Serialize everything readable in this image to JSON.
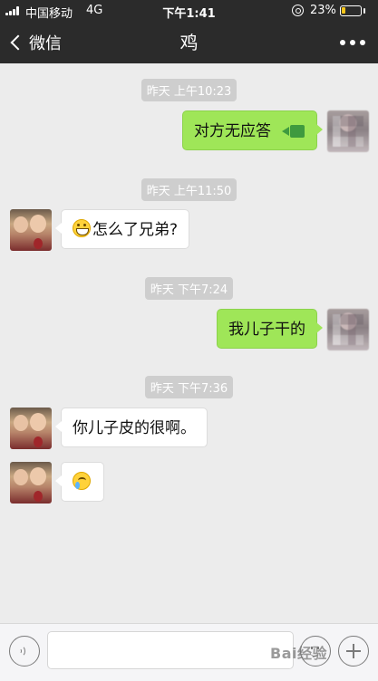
{
  "status_bar": {
    "carrier": "中国移动",
    "network": "4G",
    "time": "下午1:41",
    "battery": "23%",
    "battery_level": 0.23,
    "battery_color": "#f5c518"
  },
  "nav": {
    "back_label": "微信",
    "title": "鸡",
    "back_icon": "chevron-left-icon",
    "more_icon": "more-dots-icon"
  },
  "messages": [
    {
      "type": "timestamp",
      "text": "昨天 上午10:23"
    },
    {
      "type": "message",
      "sender": "me",
      "text": "对方无应答",
      "icon": "video-call-icon"
    },
    {
      "type": "timestamp",
      "text": "昨天 上午11:50"
    },
    {
      "type": "message",
      "sender": "them",
      "emoji": "grin-emoji-icon",
      "text": "怎么了兄弟?"
    },
    {
      "type": "timestamp",
      "text": "昨天 下午7:24"
    },
    {
      "type": "message",
      "sender": "me",
      "text": "我儿子干的"
    },
    {
      "type": "timestamp",
      "text": "昨天 下午7:36"
    },
    {
      "type": "message",
      "sender": "them",
      "text": "你儿子皮的很啊。"
    },
    {
      "type": "message",
      "sender": "them",
      "emoji": "crying-laugh-emoji-icon",
      "text": ""
    }
  ],
  "input_bar": {
    "voice_icon": "voice-icon",
    "emoji_icon": "emoji-icon",
    "plus_icon": "plus-icon",
    "text_value": ""
  },
  "watermark": "Bai经验",
  "colors": {
    "header_bg": "#2b2b2b",
    "chat_bg": "#ececec",
    "my_bubble": "#9fe658",
    "their_bubble": "#ffffff",
    "timestamp_bg": "#cecece"
  }
}
